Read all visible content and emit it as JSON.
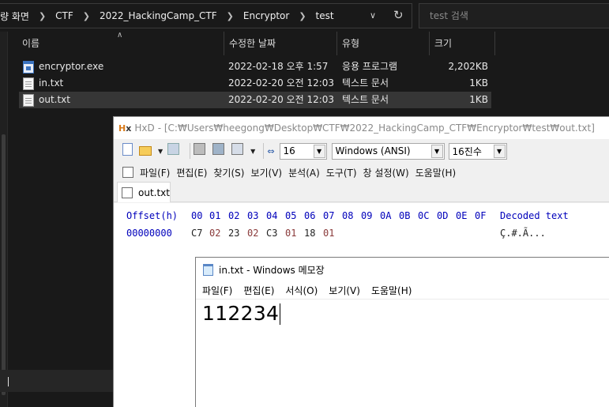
{
  "explorer": {
    "breadcrumbs": [
      "량 화면",
      "CTF",
      "2022_HackingCamp_CTF",
      "Encryptor",
      "test"
    ],
    "search_placeholder": "test 검색",
    "columns": [
      "이름",
      "수정한 날짜",
      "유형",
      "크기"
    ],
    "files": [
      {
        "name": "encryptor.exe",
        "date": "2022-02-18 오후 1:57",
        "type": "응용 프로그램",
        "size": "2,202KB",
        "icon": "exe-icon",
        "selected": false
      },
      {
        "name": "in.txt",
        "date": "2022-02-20 오전 12:03",
        "type": "텍스트 문서",
        "size": "1KB",
        "icon": "text-file-icon",
        "selected": false
      },
      {
        "name": "out.txt",
        "date": "2022-02-20 오전 12:03",
        "type": "텍스트 문서",
        "size": "1KB",
        "icon": "text-file-icon",
        "selected": true
      }
    ]
  },
  "hxd": {
    "app_name": "HxD",
    "title_path": "- [C:₩Users₩heegong₩Desktop₩CTF₩2022_HackingCamp_CTF₩Encryptor₩test₩out.txt]",
    "bytes_per_row": "16",
    "encoding": "Windows (ANSI)",
    "number_base": "16진수",
    "menu": [
      "파일(F)",
      "편집(E)",
      "찾기(S)",
      "보기(V)",
      "분석(A)",
      "도구(T)",
      "창 설정(W)",
      "도움말(H)"
    ],
    "tab_label": "out.txt",
    "offset_header": "Offset(h)",
    "column_header": [
      "00",
      "01",
      "02",
      "03",
      "04",
      "05",
      "06",
      "07",
      "08",
      "09",
      "0A",
      "0B",
      "0C",
      "0D",
      "0E",
      "0F"
    ],
    "decoded_header": "Decoded text",
    "rows": [
      {
        "offset": "00000000",
        "bytes": [
          "C7",
          "02",
          "23",
          "02",
          "C3",
          "01",
          "18",
          "01"
        ],
        "decoded": "Ç.#.Ã..."
      }
    ]
  },
  "notepad": {
    "title": "in.txt - Windows 메모장",
    "menu": [
      "파일(F)",
      "편집(E)",
      "서식(O)",
      "보기(V)",
      "도움말(H)"
    ],
    "content": "112234"
  }
}
